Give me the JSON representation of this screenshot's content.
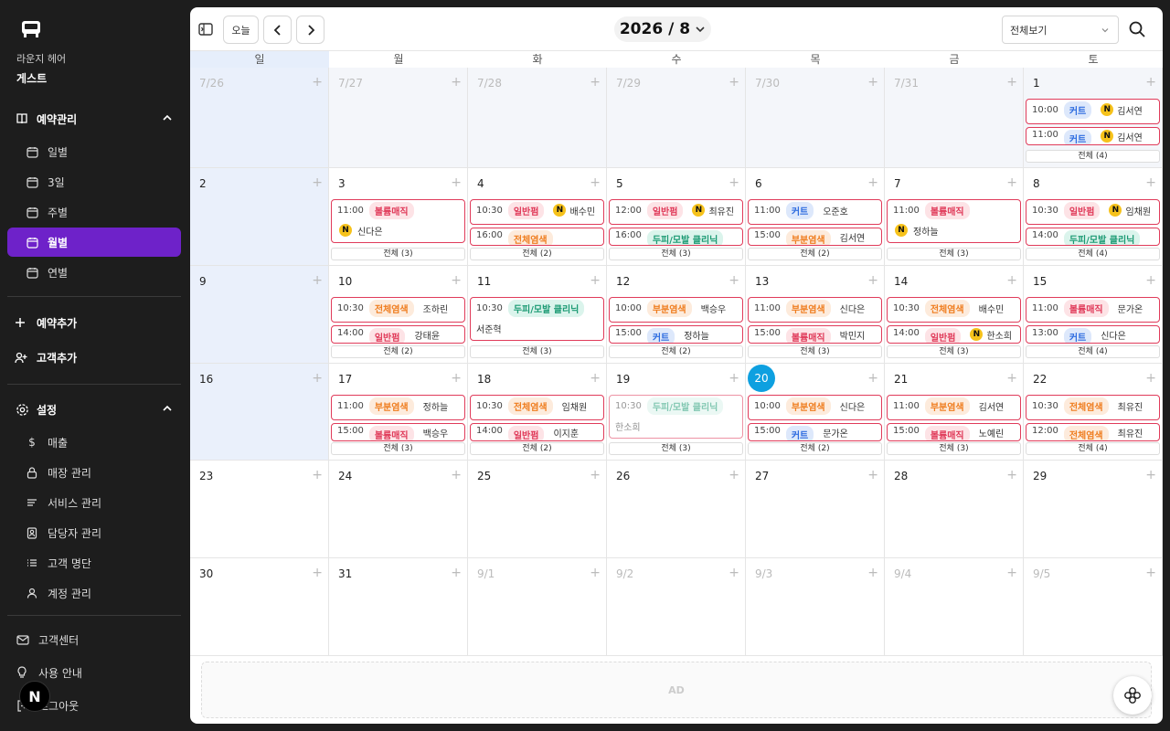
{
  "sidebar": {
    "shop_name": "라운지 헤어",
    "user_name": "게스트",
    "reservation_section": "예약관리",
    "nav": [
      "일별",
      "3일",
      "주별",
      "월별",
      "연별"
    ],
    "add_reservation": "예약추가",
    "add_customer": "고객추가",
    "settings": "설정",
    "settings_items": [
      "매출",
      "매장 관리",
      "서비스 관리",
      "담당자 관리",
      "고객 명단",
      "계정 관리"
    ],
    "footer": [
      "고객센터",
      "사용 안내",
      "로그아웃"
    ],
    "badge": "N"
  },
  "toolbar": {
    "today": "오늘",
    "year": "2026",
    "month": "/ 8",
    "view": "전체보기"
  },
  "weekdays": [
    "일",
    "월",
    "화",
    "수",
    "목",
    "금",
    "토"
  ],
  "weeks": [
    {
      "days": [
        {
          "d": "7/26",
          "other": true
        },
        {
          "d": "7/27",
          "other": true
        },
        {
          "d": "7/28",
          "other": true
        },
        {
          "d": "7/29",
          "other": true
        },
        {
          "d": "7/30",
          "other": true
        },
        {
          "d": "7/31",
          "other": true
        },
        {
          "d": "1",
          "appts": [
            {
              "t": "10:00",
              "tag": "커트",
              "c": "blue",
              "n": true,
              "name": "김서연"
            },
            {
              "t": "11:00",
              "tag": "커트",
              "c": "blue",
              "n": true,
              "name": "김서연"
            }
          ],
          "more": "전체 (4)"
        }
      ]
    },
    {
      "days": [
        {
          "d": "2"
        },
        {
          "d": "3",
          "appts": [
            {
              "t": "11:00",
              "tag": "볼륨매직",
              "c": "red",
              "n": true,
              "name": "신다은",
              "wrap": true
            }
          ],
          "more": "전체 (3)"
        },
        {
          "d": "4",
          "appts": [
            {
              "t": "10:30",
              "tag": "일반펌",
              "c": "red",
              "n": true,
              "name": "배수민"
            },
            {
              "t": "16:00",
              "tag": "전체염색",
              "c": "orange"
            }
          ],
          "more": "전체 (2)"
        },
        {
          "d": "5",
          "appts": [
            {
              "t": "12:00",
              "tag": "일반펌",
              "c": "red",
              "n": true,
              "name": "최유진"
            },
            {
              "t": "16:00",
              "tag": "두피/모발 클리닉",
              "c": "teal"
            }
          ],
          "more": "전체 (3)"
        },
        {
          "d": "6",
          "appts": [
            {
              "t": "11:00",
              "tag": "커트",
              "c": "blue",
              "name": "오준호"
            },
            {
              "t": "15:00",
              "tag": "부분염색",
              "c": "orange",
              "name": "김서연"
            }
          ],
          "more": "전체 (2)"
        },
        {
          "d": "7",
          "appts": [
            {
              "t": "11:00",
              "tag": "볼륨매직",
              "c": "red",
              "n": true,
              "name": "정하늘",
              "wrap": true
            }
          ],
          "more": "전체 (3)"
        },
        {
          "d": "8",
          "appts": [
            {
              "t": "10:30",
              "tag": "일반펌",
              "c": "red",
              "n": true,
              "name": "임채원"
            },
            {
              "t": "14:00",
              "tag": "두피/모발 클리닉",
              "c": "teal"
            }
          ],
          "more": "전체 (4)"
        }
      ]
    },
    {
      "days": [
        {
          "d": "9"
        },
        {
          "d": "10",
          "appts": [
            {
              "t": "10:30",
              "tag": "전체염색",
              "c": "orange",
              "name": "조하린"
            },
            {
              "t": "14:00",
              "tag": "일반펌",
              "c": "red",
              "name": "강태윤"
            }
          ],
          "more": "전체 (2)"
        },
        {
          "d": "11",
          "appts": [
            {
              "t": "10:30",
              "tag": "두피/모발 클리닉",
              "c": "teal",
              "name": "서준혁",
              "wrap": true
            }
          ],
          "more": "전체 (3)"
        },
        {
          "d": "12",
          "appts": [
            {
              "t": "10:00",
              "tag": "부분염색",
              "c": "orange",
              "name": "백승우"
            },
            {
              "t": "15:00",
              "tag": "커트",
              "c": "blue",
              "name": "정하늘"
            }
          ],
          "more": "전체 (2)"
        },
        {
          "d": "13",
          "appts": [
            {
              "t": "11:00",
              "tag": "부분염색",
              "c": "orange",
              "name": "신다은"
            },
            {
              "t": "15:00",
              "tag": "볼륨매직",
              "c": "red",
              "name": "박민지"
            }
          ],
          "more": "전체 (3)"
        },
        {
          "d": "14",
          "appts": [
            {
              "t": "10:30",
              "tag": "전체염색",
              "c": "orange",
              "name": "배수민"
            },
            {
              "t": "14:00",
              "tag": "일반펌",
              "c": "red",
              "n": true,
              "name": "한소희"
            }
          ],
          "more": "전체 (3)"
        },
        {
          "d": "15",
          "appts": [
            {
              "t": "11:00",
              "tag": "볼륨매직",
              "c": "red",
              "name": "문가온"
            },
            {
              "t": "13:00",
              "tag": "커트",
              "c": "blue",
              "name": "신다은"
            }
          ],
          "more": "전체 (4)"
        }
      ]
    },
    {
      "days": [
        {
          "d": "16"
        },
        {
          "d": "17",
          "appts": [
            {
              "t": "11:00",
              "tag": "부분염색",
              "c": "orange",
              "name": "정하늘"
            },
            {
              "t": "15:00",
              "tag": "볼륨매직",
              "c": "red",
              "name": "백승우"
            }
          ],
          "more": "전체 (3)"
        },
        {
          "d": "18",
          "appts": [
            {
              "t": "10:30",
              "tag": "전체염색",
              "c": "orange",
              "name": "임채원"
            },
            {
              "t": "14:00",
              "tag": "일반펌",
              "c": "red",
              "name": "이지훈"
            }
          ],
          "more": "전체 (2)"
        },
        {
          "d": "19",
          "appts": [
            {
              "t": "10:30",
              "tag": "두피/모발 클리닉",
              "c": "teal",
              "name": "한소희",
              "wrap": true,
              "faded": true
            }
          ],
          "more": "전체 (3)"
        },
        {
          "d": "20",
          "today": true,
          "appts": [
            {
              "t": "10:00",
              "tag": "부분염색",
              "c": "orange",
              "name": "신다은"
            },
            {
              "t": "15:00",
              "tag": "커트",
              "c": "blue",
              "name": "문가온"
            }
          ],
          "more": "전체 (2)"
        },
        {
          "d": "21",
          "appts": [
            {
              "t": "11:00",
              "tag": "부분염색",
              "c": "orange",
              "name": "김서연"
            },
            {
              "t": "15:00",
              "tag": "볼륨매직",
              "c": "red",
              "name": "노예린"
            }
          ],
          "more": "전체 (3)"
        },
        {
          "d": "22",
          "appts": [
            {
              "t": "10:30",
              "tag": "전체염색",
              "c": "orange",
              "name": "최유진"
            },
            {
              "t": "12:00",
              "tag": "전체염색",
              "c": "orange",
              "name": "최유진"
            }
          ],
          "more": "전체 (4)"
        }
      ]
    },
    {
      "days": [
        {
          "d": "23"
        },
        {
          "d": "24"
        },
        {
          "d": "25"
        },
        {
          "d": "26"
        },
        {
          "d": "27"
        },
        {
          "d": "28"
        },
        {
          "d": "29"
        }
      ]
    },
    {
      "days": [
        {
          "d": "30"
        },
        {
          "d": "31"
        },
        {
          "d": "9/1",
          "other": true
        },
        {
          "d": "9/2",
          "other": true
        },
        {
          "d": "9/3",
          "other": true
        },
        {
          "d": "9/4",
          "other": true
        },
        {
          "d": "9/5",
          "other": true
        }
      ]
    }
  ],
  "ad_label": "AD"
}
